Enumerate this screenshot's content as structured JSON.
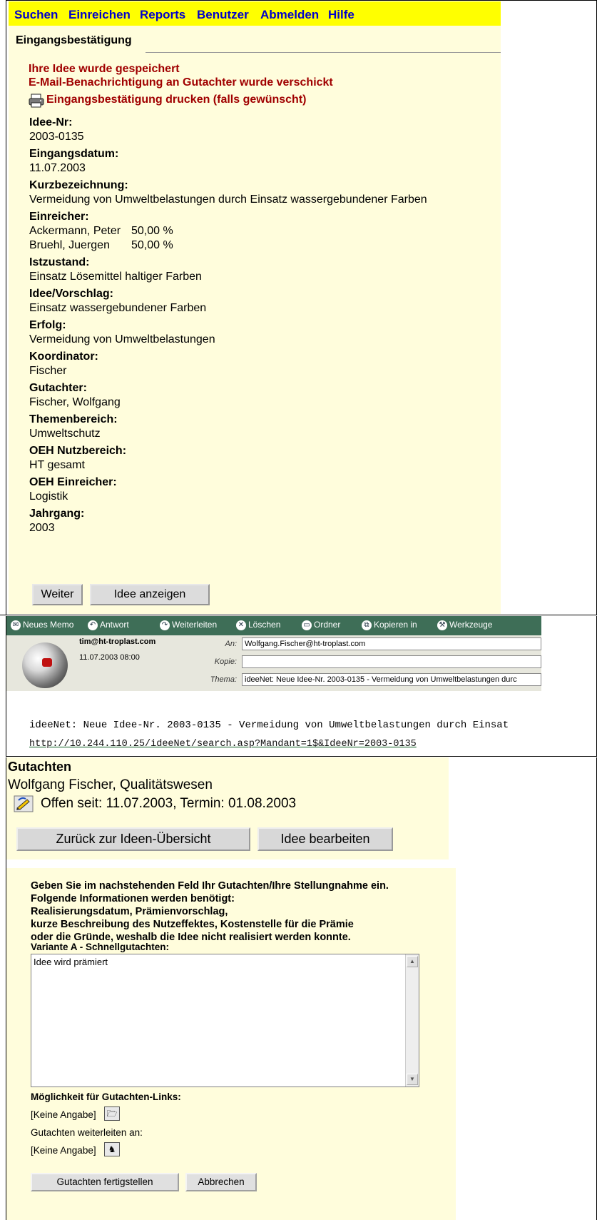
{
  "confirmation": {
    "nav": [
      "Suchen",
      "Einreichen",
      "Reports",
      "Benutzer",
      "Abmelden",
      "Hilfe"
    ],
    "heading": "Eingangsbestätigung",
    "messages": {
      "saved": "Ihre Idee wurde gespeichert",
      "email_sent": "E-Mail-Benachrichtigung an Gutachter wurde verschickt",
      "print": "Eingangsbestätigung drucken (falls gewünscht)"
    },
    "fields": [
      {
        "label": "Idee-Nr:",
        "value": "2003-0135"
      },
      {
        "label": "Eingangsdatum:",
        "value": "11.07.2003"
      },
      {
        "label": "Kurzbezeichnung:",
        "value": "Vermeidung von Umweltbelastungen durch Einsatz wassergebundener Farben"
      },
      {
        "label": "Einreicher:",
        "value": ""
      },
      {
        "label": "Istzustand:",
        "value": "Einsatz Lösemittel haltiger Farben"
      },
      {
        "label": "Idee/Vorschlag:",
        "value": "Einsatz wassergebundener Farben"
      },
      {
        "label": "Erfolg:",
        "value": "Vermeidung von Umweltbelastungen"
      },
      {
        "label": "Koordinator:",
        "value": "Fischer"
      },
      {
        "label": "Gutachter:",
        "value": "Fischer, Wolfgang"
      },
      {
        "label": "Themenbereich:",
        "value": "Umweltschutz"
      },
      {
        "label": "OEH Nutzbereich:",
        "value": "HT gesamt"
      },
      {
        "label": "OEH Einreicher:",
        "value": "Logistik"
      },
      {
        "label": "Jahrgang:",
        "value": "2003"
      }
    ],
    "submitters": [
      {
        "name": "Ackermann, Peter",
        "share": "50,00 %"
      },
      {
        "name": "Bruehl, Juergen",
        "share": "50,00 %"
      }
    ],
    "buttons": {
      "next": "Weiter",
      "show": "Idee anzeigen"
    }
  },
  "email": {
    "toolbar": [
      {
        "label": "Neues Memo",
        "icon": "memo-icon"
      },
      {
        "label": "Antwort",
        "icon": "reply-icon"
      },
      {
        "label": "Weiterleiten",
        "icon": "forward-icon"
      },
      {
        "label": "Löschen",
        "icon": "delete-icon"
      },
      {
        "label": "Ordner",
        "icon": "folder-icon"
      },
      {
        "label": "Kopieren in",
        "icon": "copy-icon"
      },
      {
        "label": "Werkzeuge",
        "icon": "tools-icon"
      }
    ],
    "sender": "tim@ht-troplast.com",
    "date": "11.07.2003 08:00",
    "to_label": "An:",
    "to": "Wolfgang.Fischer@ht-troplast.com",
    "cc_label": "Kopie:",
    "cc": "",
    "subject_label": "Thema:",
    "subject": "ideeNet: Neue Idee-Nr. 2003-0135 - Vermeidung von Umweltbelastungen durc",
    "body": "ideeNet: Neue Idee-Nr. 2003-0135 - Vermeidung von Umweltbelastungen durch Einsat",
    "link": "http://10.244.110.25/ideeNet/search.asp?Mandant=1$&IdeeNr=2003-0135"
  },
  "review": {
    "title": "Gutachten",
    "reviewer": "Wolfgang Fischer, Qualitätswesen",
    "status": "Offen seit: 11.07.2003, Termin: 01.08.2003",
    "buttons": {
      "back": "Zurück zur Ideen-Übersicht",
      "edit": "Idee bearbeiten"
    },
    "instructions": [
      "Geben Sie im nachstehenden Feld Ihr Gutachten/Ihre Stellungnahme ein.",
      "Folgende Informationen werden benötigt:",
      "Realisierungsdatum, Prämienvorschlag,",
      "kurze Beschreibung des Nutzeffektes, Kostenstelle für die Prämie",
      "oder die Gründe, weshalb die Idee nicht realisiert werden konnte."
    ],
    "variant_label": "Variante A - Schnellgutachten:",
    "textarea_value": "Idee wird prämiert",
    "links_label": "Möglichkeit für Gutachten-Links:",
    "links_value": "[Keine Angabe]",
    "forward_label": "Gutachten weiterleiten an:",
    "forward_value": "[Keine Angabe]",
    "finish_button": "Gutachten fertigstellen",
    "cancel_button": "Abbrechen"
  }
}
